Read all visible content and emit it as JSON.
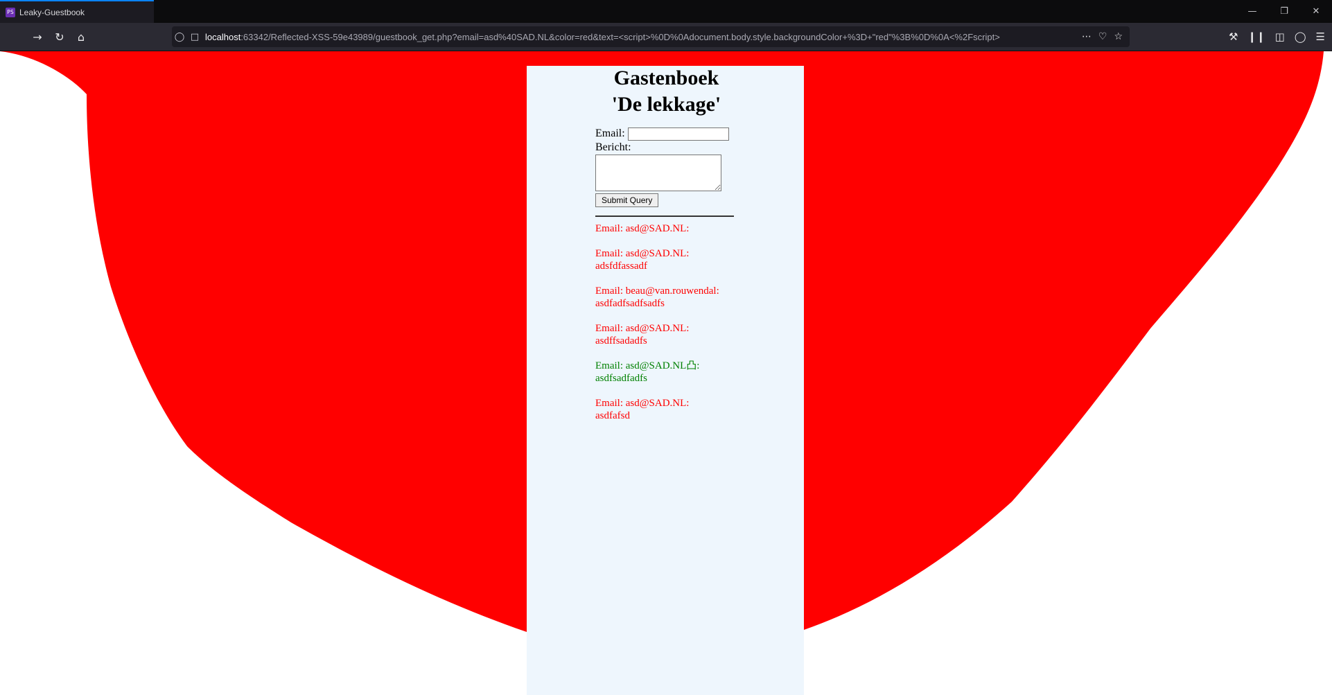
{
  "browser": {
    "tab_title": "Leaky-Guestbook",
    "tab_favicon": "PS",
    "url_host": "localhost",
    "url_rest": ":63342/Reflected-XSS-59e43989/guestbook_get.php?email=asd%40SAD.NL&color=red&text=<script>%0D%0Adocument.body.style.backgroundColor+%3D+\"red\"%3B%0D%0A<%2Fscript>",
    "icons": {
      "back": "back-arrow-icon",
      "reload": "reload-icon",
      "home": "home-icon",
      "shield": "tracking-protection-icon",
      "page": "page-info-icon",
      "more": "more-actions-icon",
      "pocket": "pocket-icon",
      "bookmark": "bookmark-star-icon",
      "tools": "wrench-icon",
      "library": "library-icon",
      "sidebar": "sidebar-icon",
      "account": "account-icon",
      "menu": "hamburger-menu-icon"
    }
  },
  "page": {
    "background_color": "#ff0000",
    "panel_color": "#eef6fd",
    "title_line1": "Gastenboek",
    "title_line2": "'De lekkage'",
    "form": {
      "email_label": "Email:",
      "email_value": "",
      "message_label": "Bericht:",
      "message_value": "",
      "submit_label": "Submit Query"
    },
    "entries": [
      {
        "header": "Email: asd@SAD.NL:",
        "message": "",
        "color": "#ff0000"
      },
      {
        "header": "Email: asd@SAD.NL:",
        "message": "adsfdfassadf",
        "color": "#ff0000"
      },
      {
        "header": "Email: beau@van.rouwendal:",
        "message": "asdfadfsadfsadfs",
        "color": "#ff0000"
      },
      {
        "header": "Email: asd@SAD.NL:",
        "message": "asdffsadadfs",
        "color": "#ff0000"
      },
      {
        "header": "Email: asd@SAD.NL凸:",
        "message": "asdfsadfadfs",
        "color": "#008000"
      },
      {
        "header": "Email: asd@SAD.NL:",
        "message": "asdfafsd",
        "color": "#ff0000"
      }
    ]
  }
}
